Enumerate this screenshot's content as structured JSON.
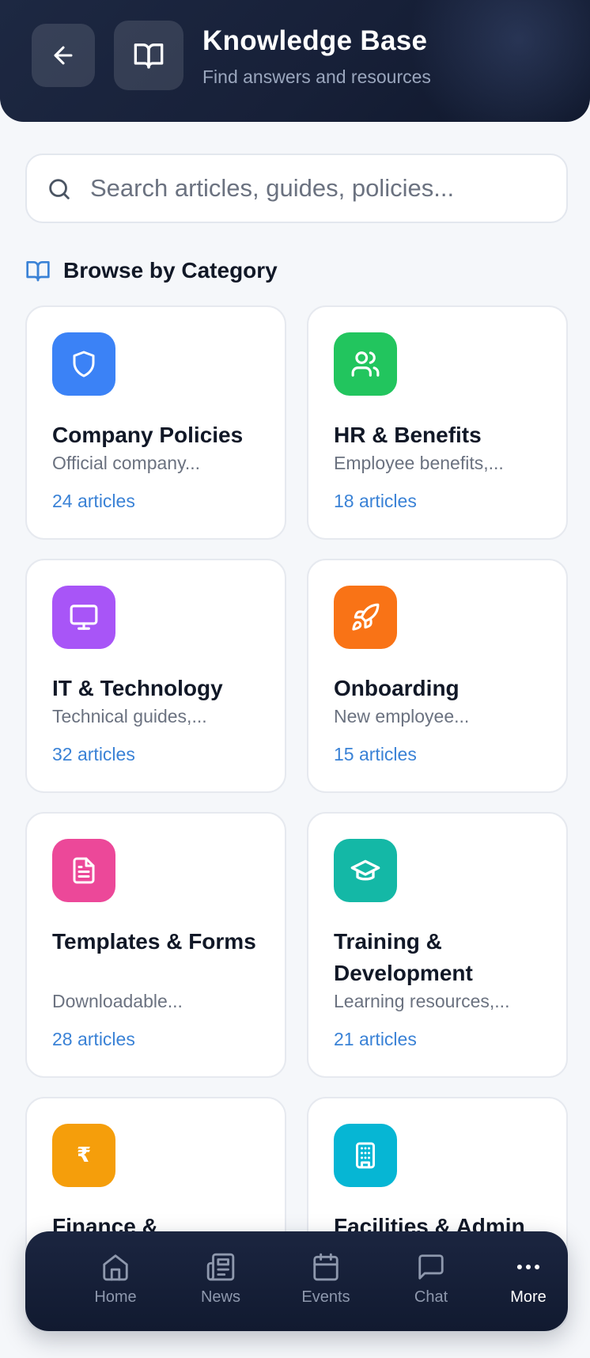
{
  "header": {
    "title": "Knowledge Base",
    "subtitle": "Find answers and resources",
    "back_icon": "arrow-left-icon",
    "book_icon": "book-open-icon"
  },
  "search": {
    "placeholder": "Search articles, guides, policies...",
    "value": ""
  },
  "section": {
    "title": "Browse by Category",
    "icon": "book-open-icon"
  },
  "categories": [
    {
      "title": "Company Policies",
      "description": "Official company...",
      "count": "24 articles",
      "icon": "shield-icon",
      "color": "#3b82f6"
    },
    {
      "title": "HR & Benefits",
      "description": "Employee benefits,...",
      "count": "18 articles",
      "icon": "users-icon",
      "color": "#22c55e"
    },
    {
      "title": "IT & Technology",
      "description": "Technical guides,...",
      "count": "32 articles",
      "icon": "monitor-icon",
      "color": "#a855f7"
    },
    {
      "title": "Onboarding",
      "description": "New employee...",
      "count": "15 articles",
      "icon": "rocket-icon",
      "color": "#f97316"
    },
    {
      "title": "Templates & Forms",
      "description": "Downloadable...",
      "count": "28 articles",
      "icon": "file-text-icon",
      "color": "#ec4899"
    },
    {
      "title": "Training & Development",
      "description": "Learning resources,...",
      "count": "21 articles",
      "icon": "graduation-cap-icon",
      "color": "#14b8a6"
    },
    {
      "title": "Finance &",
      "description": "",
      "count": "",
      "icon": "rupee-icon",
      "color": "#f59e0b"
    },
    {
      "title": "Facilities & Admin",
      "description": "",
      "count": "",
      "icon": "building-icon",
      "color": "#06b6d4"
    }
  ],
  "nav": {
    "items": [
      {
        "label": "Home",
        "icon": "home-icon",
        "active": false
      },
      {
        "label": "News",
        "icon": "newspaper-icon",
        "active": false
      },
      {
        "label": "Events",
        "icon": "calendar-icon",
        "active": false
      },
      {
        "label": "Chat",
        "icon": "message-square-icon",
        "active": false
      },
      {
        "label": "More",
        "icon": "more-horizontal-icon",
        "active": true
      }
    ]
  },
  "colors": {
    "accent": "#3a82d6",
    "header_bg": "#1a2440",
    "nav_bg": "#151f38"
  }
}
